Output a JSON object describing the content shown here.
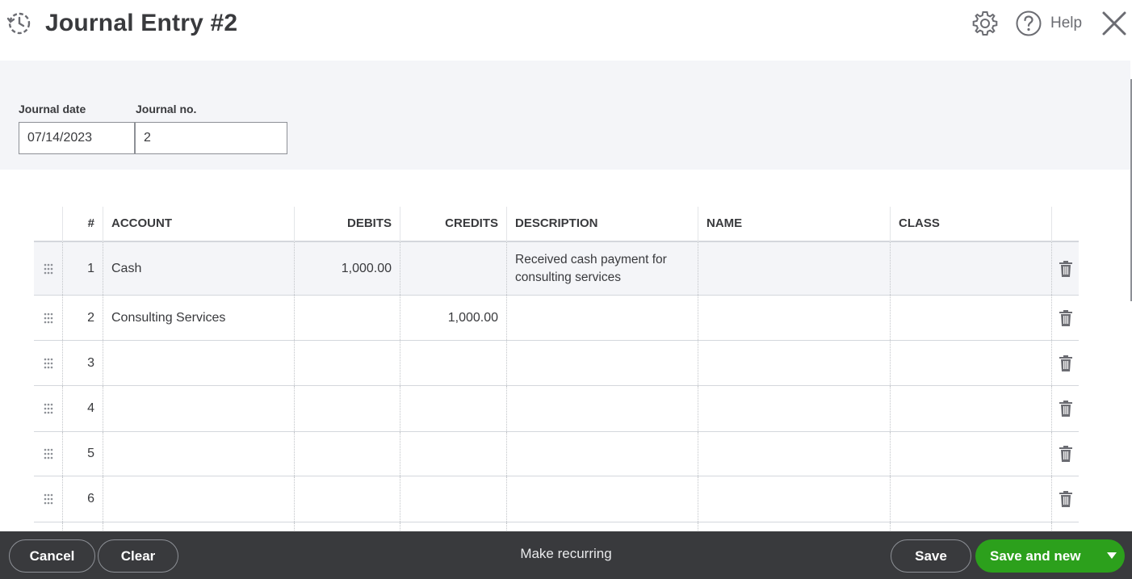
{
  "header": {
    "title": "Journal Entry #2",
    "help_label": "Help"
  },
  "form": {
    "journal_date_label": "Journal date",
    "journal_date_value": "07/14/2023",
    "journal_no_label": "Journal no.",
    "journal_no_value": "2"
  },
  "table": {
    "columns": {
      "num": "#",
      "account": "ACCOUNT",
      "debits": "DEBITS",
      "credits": "CREDITS",
      "description": "DESCRIPTION",
      "name": "NAME",
      "class": "CLASS"
    },
    "rows": [
      {
        "num": "1",
        "account": "Cash",
        "debits": "1,000.00",
        "credits": "",
        "description": "Received cash payment for consulting services",
        "name": "",
        "class": ""
      },
      {
        "num": "2",
        "account": "Consulting Services",
        "debits": "",
        "credits": "1,000.00",
        "description": "",
        "name": "",
        "class": ""
      },
      {
        "num": "3",
        "account": "",
        "debits": "",
        "credits": "",
        "description": "",
        "name": "",
        "class": ""
      },
      {
        "num": "4",
        "account": "",
        "debits": "",
        "credits": "",
        "description": "",
        "name": "",
        "class": ""
      },
      {
        "num": "5",
        "account": "",
        "debits": "",
        "credits": "",
        "description": "",
        "name": "",
        "class": ""
      },
      {
        "num": "6",
        "account": "",
        "debits": "",
        "credits": "",
        "description": "",
        "name": "",
        "class": ""
      }
    ]
  },
  "footer": {
    "cancel_label": "Cancel",
    "clear_label": "Clear",
    "make_recurring_label": "Make recurring",
    "save_label": "Save",
    "save_and_new_label": "Save and new"
  },
  "colors": {
    "primary_green": "#2ca01c",
    "footer_bg": "#393a3d",
    "form_band_bg": "#f4f5f8",
    "text": "#393a3d"
  },
  "icons": [
    "history-icon",
    "gear-icon",
    "help-icon",
    "close-icon",
    "drag-handle-icon",
    "trash-icon",
    "chevron-down-icon"
  ]
}
